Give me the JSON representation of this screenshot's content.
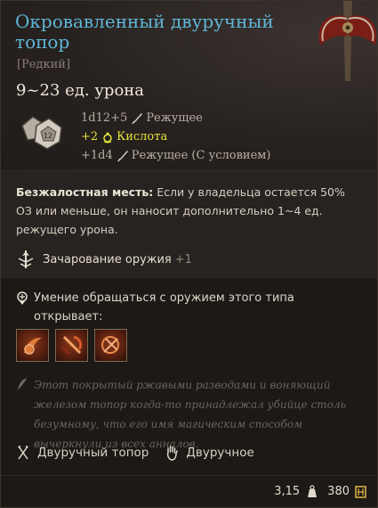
{
  "item": {
    "name": "Окровавленный двуручный топор",
    "rarity": "[Редкий]",
    "damage_range": "9~23 ед. урона",
    "damage_lines": [
      {
        "dice": "1d12+5",
        "type": "Режущее",
        "icon": "blade-icon",
        "color": "#b9b0a3"
      },
      {
        "dice": "+2",
        "type": "Кислота",
        "icon": "acid-icon",
        "color": "#e8e43a"
      },
      {
        "dice": "+1d4",
        "type": "Режущее (С условием)",
        "icon": "blade-icon",
        "color": "#b9b0a3"
      }
    ],
    "dice_icon_label": "12"
  },
  "passive": {
    "name": "Безжалостная месть:",
    "text": "Если у владельца остается 50% ОЗ или меньше, он наносит дополнительно 1~4 ед. режущего урона."
  },
  "enchantment": {
    "label": "Зачарование оружия",
    "value": "+1"
  },
  "proficiency": {
    "text": "Умение обращаться с оружием этого типа открывает:",
    "actions": [
      "cleave-action-icon",
      "lacerate-action-icon",
      "tenacity-action-icon"
    ]
  },
  "lore": "Этот покрытый ржавыми разводами и воняющий железом топор когда-то принадлежал убийце столь безумному, что его имя магическим способом вычеркнули из всех анналов.",
  "properties": {
    "weapon_type": "Двуручный топор",
    "handedness": "Двуручное"
  },
  "footer": {
    "weight": "3,15",
    "value": "380"
  },
  "colors": {
    "title": "#5fb6d6",
    "acid": "#e8e43a",
    "background": "#1c1916"
  }
}
